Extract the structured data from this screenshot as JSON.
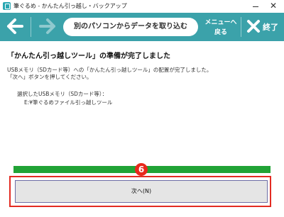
{
  "window": {
    "title": "筆ぐるめ - かんたん引っ越し・バックアップ",
    "close_glyph": "✕"
  },
  "toolbar": {
    "step_title": "別のパソコンからデータを取り込む",
    "menu_line1": "メニューへ",
    "menu_line2": "戻る",
    "exit_label": "終了"
  },
  "content": {
    "heading": "「かんたん引っ越しツール」の準備が完了しました",
    "message_line1": "USBメモリ（SDカード等）への「かんたん引っ越しツール」の配置が完了しました。",
    "message_line2": "「次へ」ボタンを押してください。",
    "selected_label": "選択したUSBメモリ（SDカード等）：",
    "selected_path": "E:¥筆ぐるめファイル引っ越しツール"
  },
  "progress": {
    "value": 1.0
  },
  "annotation": {
    "step_number": "6"
  },
  "next_button": {
    "label": "次へ(N)"
  },
  "colors": {
    "toolbar": "#3ba2aa",
    "progress": "#21a336",
    "highlight": "#e32b22"
  },
  "icons": [
    "app-icon",
    "back-arrow-icon",
    "forward-arrow-icon",
    "exit-x-icon"
  ]
}
